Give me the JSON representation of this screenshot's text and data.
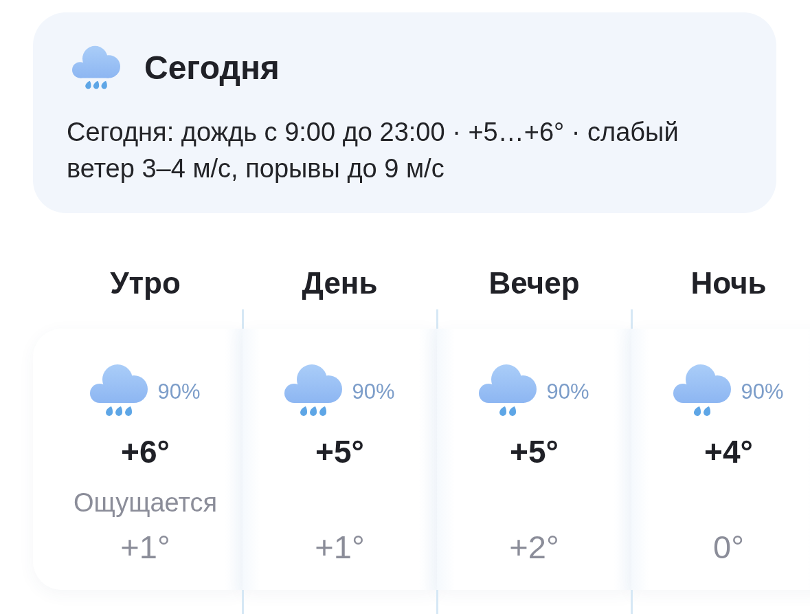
{
  "today": {
    "title": "Сегодня",
    "kind": "rain",
    "summary": "Сегодня: дождь с 9:00 до 23:00 · +5…+6° · слабый ветер 3–4 м/с, порывы до 9 м/с"
  },
  "periods": [
    {
      "name": "Утро",
      "kind": "rain",
      "precipitation": "90%",
      "temperature": "+6°",
      "feels_like_label": "Ощущается",
      "feels_like": "+1°"
    },
    {
      "name": "День",
      "kind": "rain",
      "precipitation": "90%",
      "temperature": "+5°",
      "feels_like": "+1°"
    },
    {
      "name": "Вечер",
      "kind": "light_rain",
      "precipitation": "90%",
      "temperature": "+5°",
      "feels_like": "+2°"
    },
    {
      "name": "Ночь",
      "kind": "light_rain",
      "precipitation": "90%",
      "temperature": "+4°",
      "feels_like": "0°"
    }
  ]
}
